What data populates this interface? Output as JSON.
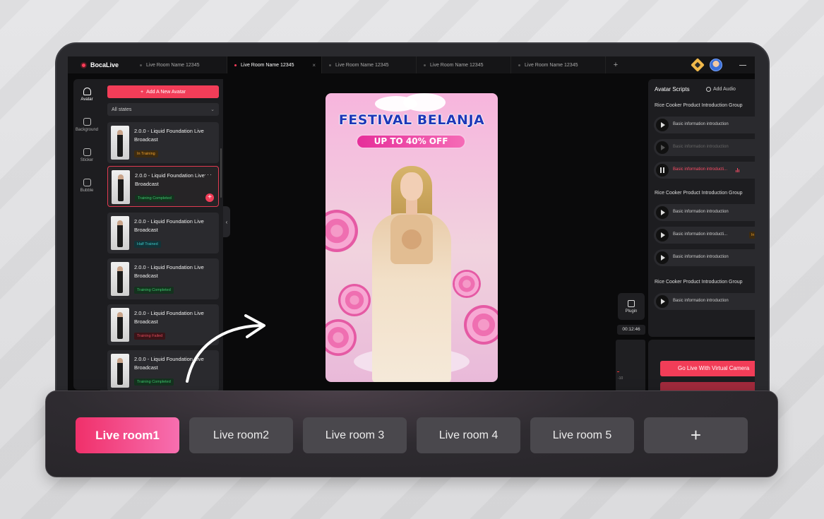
{
  "app": {
    "brand": "BocaLive"
  },
  "tabs": [
    {
      "label": "Live Room Name 12345",
      "active": false
    },
    {
      "label": "Live Room Name 12345",
      "active": true,
      "close": "×"
    },
    {
      "label": "Live Room Name 12345",
      "active": false
    },
    {
      "label": "Live Room Name 12345",
      "active": false
    },
    {
      "label": "Live Room Name 12345",
      "active": false
    }
  ],
  "tab_add": "+",
  "rail": [
    {
      "label": "Avatar",
      "icon": "person-icon",
      "active": true
    },
    {
      "label": "Background",
      "icon": "background-icon",
      "active": false
    },
    {
      "label": "Sticker",
      "icon": "sticker-icon",
      "active": false
    },
    {
      "label": "Bubble",
      "icon": "bubble-icon",
      "active": false
    }
  ],
  "avatar_panel": {
    "add_button": "Add A New Avatar",
    "filter": "All states",
    "cards": [
      {
        "title": "2.0.0 - Liquid Foundation Live Broadcast",
        "status": "In Training",
        "status_color": "#f0a02c"
      },
      {
        "title": "2.0.0 - Liquid Foundation Live Broadcast",
        "status": "Training Completed",
        "status_color": "#3cc46c",
        "selected": true
      },
      {
        "title": "2.0.0 - Liquid Foundation Live Broadcast",
        "status": "Half Trained",
        "status_color": "#3cc4c4"
      },
      {
        "title": "2.0.0 - Liquid Foundation Live Broadcast",
        "status": "Training Completed",
        "status_color": "#3cc46c"
      },
      {
        "title": "2.0.0 - Liquid Foundation Live Broadcast",
        "status": "Training Failed",
        "status_color": "#e04a5a"
      },
      {
        "title": "2.0.0 - Liquid Foundation Live Broadcast",
        "status": "Training Completed",
        "status_color": "#3cc46c"
      }
    ]
  },
  "preview": {
    "title": "FESTIVAL BELANJA",
    "badge": "UP TO 40% OFF"
  },
  "scripts_panel": {
    "title": "Avatar Scripts",
    "add_audio": "Add Audio",
    "groups": [
      {
        "name": "Rice Cooker Product Introduction Group",
        "rows": [
          {
            "label": "Basic information introduction",
            "state": "normal"
          },
          {
            "label": "Basic information introduction",
            "state": "dim"
          },
          {
            "label": "Basic information introducti...",
            "state": "playing"
          }
        ]
      },
      {
        "name": "Rice Cooker Product Introduction Group",
        "rows": [
          {
            "label": "Basic information introduction",
            "state": "normal"
          },
          {
            "label": "Basic information introducti...",
            "state": "normal",
            "tag": "In"
          },
          {
            "label": "Basic information introduction",
            "state": "normal"
          }
        ]
      },
      {
        "name": "Rice Cooker Product Introduction Group",
        "rows": [
          {
            "label": "Basic information introduction",
            "state": "normal"
          }
        ]
      }
    ]
  },
  "plugin": {
    "label": "Plugin"
  },
  "timer": "00:12:46",
  "meter": {
    "scale_label": "-10"
  },
  "go_live": "Go Live With Virtual Camera",
  "room_bar": {
    "rooms": [
      {
        "label": "Live room1",
        "active": true
      },
      {
        "label": "Live room2",
        "active": false
      },
      {
        "label": "Live room 3",
        "active": false
      },
      {
        "label": "Live room 4",
        "active": false
      },
      {
        "label": "Live room 5",
        "active": false
      }
    ],
    "add": "+"
  },
  "colors": {
    "accent": "#f23d58",
    "room_active_start": "#f0306a",
    "room_active_end": "#f76fb0"
  }
}
